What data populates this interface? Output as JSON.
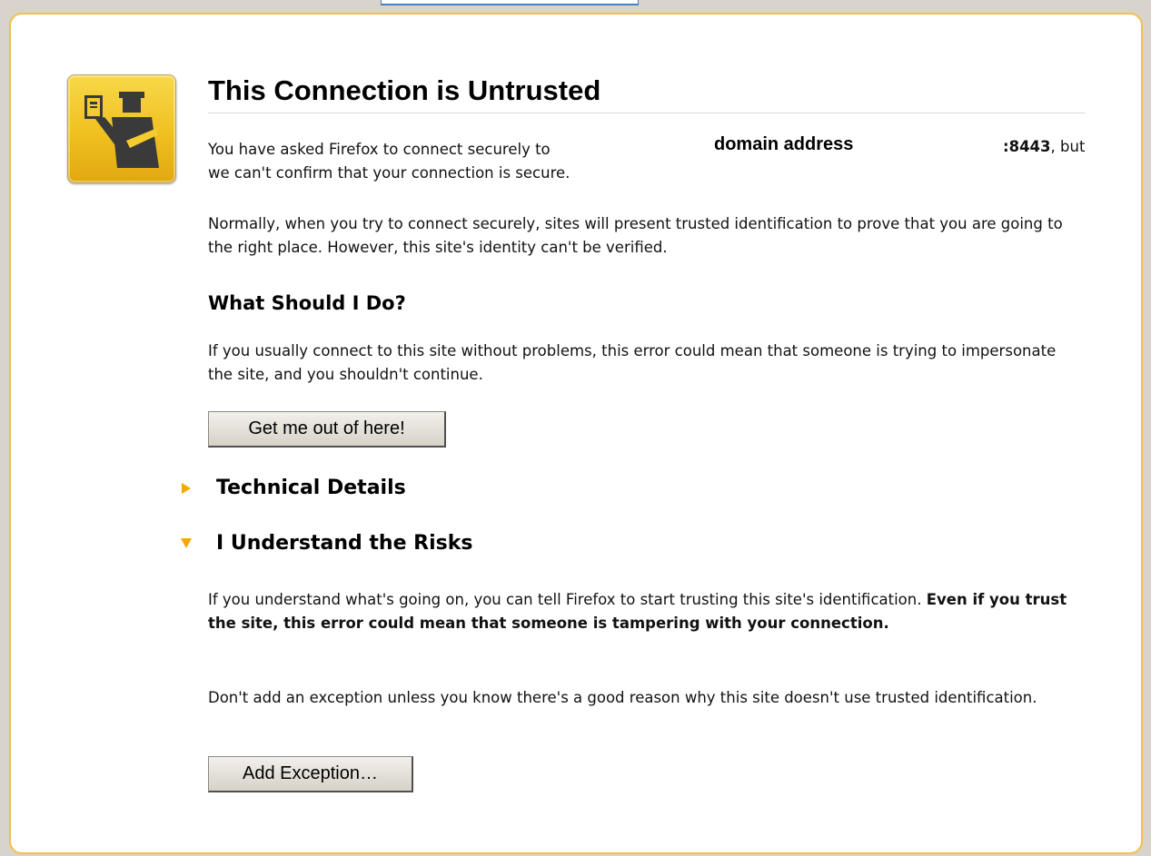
{
  "page": {
    "title": "This Connection is Untrusted",
    "intro_before": "You have asked Firefox to connect securely to",
    "domain_placeholder": "domain address",
    "port": ":8443",
    "intro_after_port": ", but",
    "intro_line2": "we can't confirm that your connection is secure.",
    "normally_text": "Normally, when you try to connect securely, sites will present trusted identification to prove that you are going to the right place. However, this site's identity can't be verified.",
    "what_heading": "What Should I Do?",
    "what_text": "If you usually connect to this site without problems, this error could mean that someone is trying to impersonate the site, and you shouldn't continue.",
    "get_out_button": "Get me out of here!",
    "technical_details": "Technical Details",
    "understand_risks": "I Understand the Risks",
    "risks_text_plain": "If you understand what's going on, you can tell Firefox to start trusting this site's identification. ",
    "risks_text_bold": "Even if you trust the site, this error could mean that someone is tampering with your connection.",
    "exception_text": "Don't add an exception unless you know there's a good reason why this site doesn't use trusted identification.",
    "add_exception_button": "Add Exception…"
  },
  "colors": {
    "panel_border": "#f0c04a",
    "expander_triangle": "#f5a800",
    "background": "#d8d4cc"
  },
  "icons": {
    "cert_icon": "certificate-officer-icon",
    "tech_expander": "triangle-right-icon",
    "risks_expander": "triangle-down-icon"
  }
}
